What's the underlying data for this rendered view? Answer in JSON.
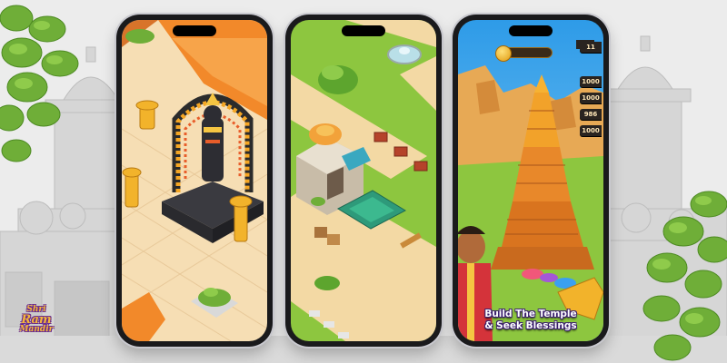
{
  "brand": {
    "logo_line1": "Shri",
    "logo_line2": "Ram",
    "logo_line3": "Mandir"
  },
  "phones": [
    {
      "name": "idol-shrine-screen"
    },
    {
      "name": "village-map-screen"
    },
    {
      "name": "temple-build-screen"
    }
  ],
  "hud": {
    "top_value": "11",
    "resource_values": [
      "1000",
      "1000",
      "986",
      "1000"
    ]
  },
  "tagline": {
    "line1": "Build The Temple",
    "line2": "& Seek Blessings"
  },
  "colors": {
    "background": "#e9e9e9",
    "phone_frame": "#1a1a1c",
    "logo_gold": "#f4b63b",
    "logo_purple": "#6a2a8a",
    "orange_platform": "#f2892a",
    "grass": "#8dc63f",
    "sky": "#3aa8f0"
  }
}
